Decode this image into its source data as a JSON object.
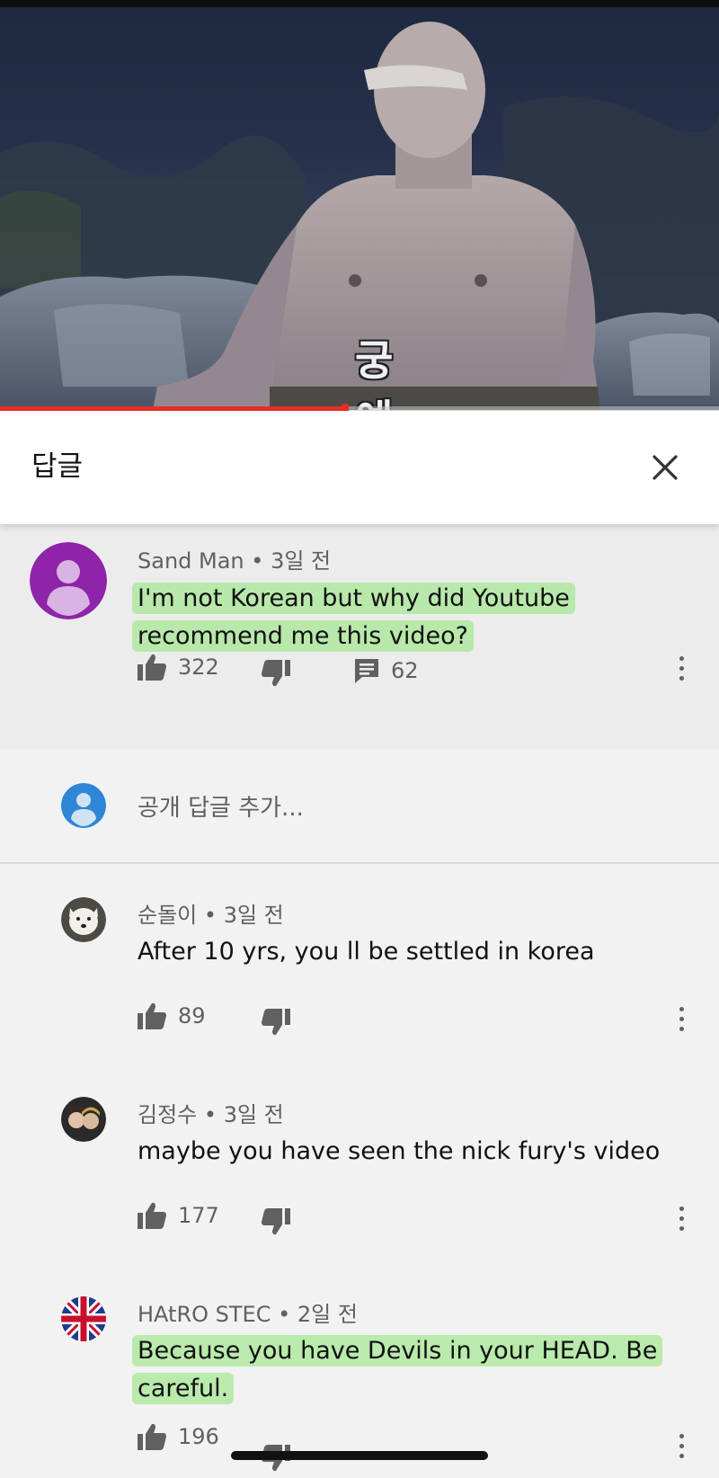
{
  "video": {
    "caption": "궁 예",
    "progress": 0.48
  },
  "header": {
    "title": "답글",
    "close_icon": "close-icon"
  },
  "parent_comment": {
    "author": "Sand Man",
    "time": "3일 전",
    "text": "I'm not Korean but why did Youtube recommend me this video?",
    "likes": "322",
    "replies": "62",
    "avatar_color": "#8e24aa",
    "highlighted": true
  },
  "add_reply": {
    "placeholder": "공개 답글 추가..."
  },
  "replies": [
    {
      "author": "순돌이",
      "time": "3일 전",
      "text": "After 10 yrs, you ll be settled in korea",
      "likes": "89",
      "highlighted": false
    },
    {
      "author": "김정수",
      "time": "3일 전",
      "text": "maybe you have seen the nick fury's video",
      "likes": "177",
      "highlighted": false
    },
    {
      "author": "HAtRO STEC",
      "time": "2일 전",
      "text": "Because you have Devils in your HEAD. Be careful.",
      "likes": "196",
      "highlighted": true
    }
  ],
  "colors": {
    "highlight": "#a7e794",
    "progress": "#e52d27",
    "meta_text": "#606060"
  }
}
